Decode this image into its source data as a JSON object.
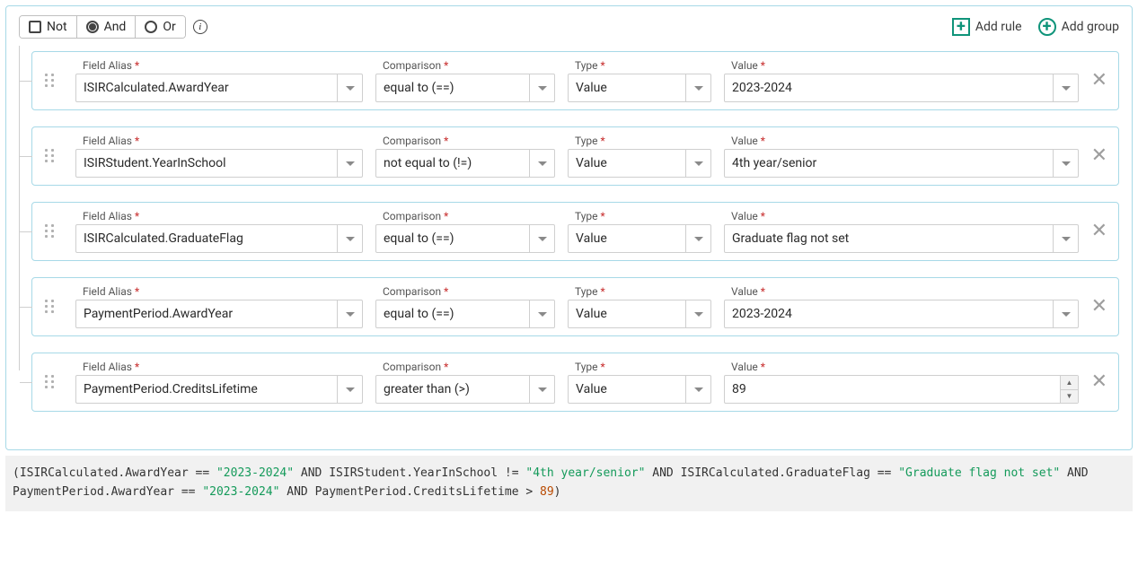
{
  "toolbar": {
    "not": "Not",
    "and": "And",
    "or": "Or",
    "selected": "And",
    "addRule": "Add rule",
    "addGroup": "Add group"
  },
  "labels": {
    "fieldAlias": "Field Alias",
    "comparison": "Comparison",
    "type": "Type",
    "value": "Value"
  },
  "rules": [
    {
      "alias": "ISIRCalculated.AwardYear",
      "comparison": "equal to (==)",
      "type": "Value",
      "value": "2023-2024",
      "numeric": false
    },
    {
      "alias": "ISIRStudent.YearInSchool",
      "comparison": "not equal to (!=)",
      "type": "Value",
      "value": "4th year/senior",
      "numeric": false
    },
    {
      "alias": "ISIRCalculated.GraduateFlag",
      "comparison": "equal to (==)",
      "type": "Value",
      "value": "Graduate flag not set",
      "numeric": false
    },
    {
      "alias": "PaymentPeriod.AwardYear",
      "comparison": "equal to (==)",
      "type": "Value",
      "value": "2023-2024",
      "numeric": false
    },
    {
      "alias": "PaymentPeriod.CreditsLifetime",
      "comparison": "greater than (>)",
      "type": "Value",
      "value": "89",
      "numeric": true
    }
  ],
  "expression": {
    "tokens": [
      {
        "t": "("
      },
      {
        "t": "ISIRCalculated.AwardYear == "
      },
      {
        "t": "\"2023-2024\"",
        "c": "str"
      },
      {
        "t": " AND "
      },
      {
        "t": "ISIRStudent.YearInSchool != "
      },
      {
        "t": "\"4th year/senior\"",
        "c": "str"
      },
      {
        "t": " AND "
      },
      {
        "t": "ISIRCalculated.GraduateFlag == "
      },
      {
        "t": "\"Graduate flag not set\"",
        "c": "str"
      },
      {
        "t": " AND "
      },
      {
        "t": "PaymentPeriod.AwardYear == "
      },
      {
        "t": "\"2023-2024\"",
        "c": "str"
      },
      {
        "t": " AND "
      },
      {
        "t": "PaymentPeriod.CreditsLifetime > "
      },
      {
        "t": "89",
        "c": "num"
      },
      {
        "t": ")"
      }
    ]
  }
}
